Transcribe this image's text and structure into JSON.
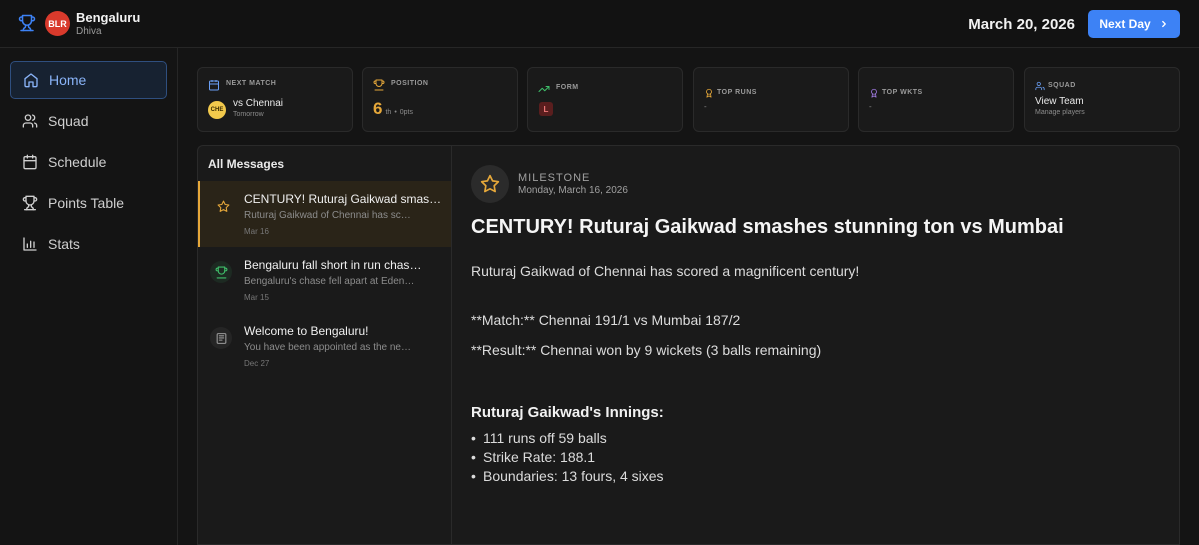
{
  "header": {
    "team_name": "Bengaluru",
    "team_abbr": "BLR",
    "manager": "Dhiva",
    "date": "March 20, 2026",
    "next_day_label": "Next Day",
    "colors": {
      "team_badge": "#d93a2c",
      "primary": "#3d82f5"
    }
  },
  "sidebar": {
    "items": [
      {
        "label": "Home",
        "icon": "home-icon",
        "active": true
      },
      {
        "label": "Squad",
        "icon": "users-icon",
        "active": false
      },
      {
        "label": "Schedule",
        "icon": "calendar-icon",
        "active": false
      },
      {
        "label": "Points Table",
        "icon": "trophy-icon",
        "active": false
      },
      {
        "label": "Stats",
        "icon": "bar-chart-icon",
        "active": false
      }
    ]
  },
  "cards": {
    "next_match": {
      "label": "NEXT MATCH",
      "opponent_abbr": "CHE",
      "opponent": "vs Chennai",
      "when": "Tomorrow"
    },
    "position": {
      "label": "POSITION",
      "rank": "6",
      "suffix": "th",
      "sep": "•",
      "points": "0pts"
    },
    "form": {
      "label": "FORM",
      "results": [
        "L"
      ]
    },
    "top_runs": {
      "label": "TOP RUNS",
      "value": "-"
    },
    "top_wkts": {
      "label": "TOP WKTS",
      "value": "-"
    },
    "squad": {
      "label": "SQUAD",
      "title": "View Team",
      "subtitle": "Manage players"
    }
  },
  "messages": {
    "header": "All Messages",
    "items": [
      {
        "icon": "star-icon",
        "title": "CENTURY! Ruturaj Gaikwad smashes stunning ton vs Mumbai",
        "preview": "Ruturaj Gaikwad of Chennai has scored a magnificent century!",
        "date": "Mar 16",
        "active": true
      },
      {
        "icon": "trophy-icon",
        "title": "Bengaluru fall short in run chase vs Kolkata",
        "preview": "Bengaluru's chase fell apart at Eden Gardens",
        "date": "Mar 15",
        "active": false
      },
      {
        "icon": "newspaper-icon",
        "title": "Welcome to Bengaluru!",
        "preview": "You have been appointed as the new manager",
        "date": "Dec 27",
        "active": false
      }
    ]
  },
  "detail": {
    "type": "MILESTONE",
    "date": "Monday, March 16, 2026",
    "title": "CENTURY! Ruturaj Gaikwad smashes stunning ton vs Mumbai",
    "intro": "Ruturaj Gaikwad of Chennai has scored a magnificent century!",
    "match_line": "**Match:** Chennai 191/1 vs Mumbai 187/2",
    "result_line": "**Result:** Chennai won by 9 wickets (3 balls remaining)",
    "innings_heading": "Ruturaj Gaikwad's Innings:",
    "innings": [
      "111 runs off 59 balls",
      "Strike Rate: 188.1",
      "Boundaries: 13 fours, 4 sixes"
    ]
  }
}
